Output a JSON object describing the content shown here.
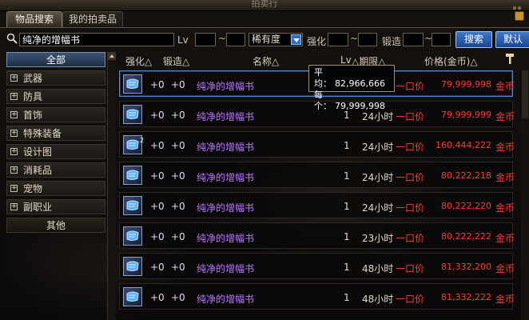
{
  "window": {
    "title": "拍卖行"
  },
  "tabs": [
    {
      "label": "物品搜索"
    },
    {
      "label": "我的拍卖品"
    }
  ],
  "search": {
    "query": "纯净的增幅书",
    "lv_label": "Lv",
    "tilde": "~",
    "rarity_select": "稀有度",
    "enhance_label": "强化",
    "forge_label": "锻造",
    "search_button": "搜索",
    "default_button": "默认"
  },
  "sidebar": {
    "items": [
      {
        "label": "全部",
        "expandable": false,
        "selected": true
      },
      {
        "label": "武器",
        "expandable": true
      },
      {
        "label": "防具",
        "expandable": true
      },
      {
        "label": "首饰",
        "expandable": true
      },
      {
        "label": "特殊装备",
        "expandable": true
      },
      {
        "label": "设计图",
        "expandable": true
      },
      {
        "label": "消耗品",
        "expandable": true
      },
      {
        "label": "宠物",
        "expandable": true
      },
      {
        "label": "副职业",
        "expandable": true
      },
      {
        "label": "其他",
        "expandable": false
      }
    ]
  },
  "columns": {
    "enhance": "强化△",
    "forge": "锻造△",
    "name": "名称△",
    "lv": "Lv",
    "period": "△期限△",
    "price": "价格(金币)△"
  },
  "rows": [
    {
      "enhance": "+0",
      "forge": "+0",
      "name": "纯净的增幅书",
      "lv": "",
      "time": "",
      "buy": "一口价",
      "price": "79,999,998",
      "unit": "金币",
      "qty": "",
      "selected": true
    },
    {
      "enhance": "+0",
      "forge": "+0",
      "name": "纯净的增幅书",
      "lv": "1",
      "time": "24小时",
      "buy": "一口价",
      "price": "79,999,999",
      "unit": "金币",
      "qty": ""
    },
    {
      "enhance": "+0",
      "forge": "+0",
      "name": "纯净的增幅书",
      "lv": "1",
      "time": "24小时",
      "buy": "一口价",
      "price": "160,444,222",
      "unit": "金币",
      "qty": "2"
    },
    {
      "enhance": "+0",
      "forge": "+0",
      "name": "纯净的增幅书",
      "lv": "1",
      "time": "24小时",
      "buy": "一口价",
      "price": "80,222,218",
      "unit": "金币",
      "qty": ""
    },
    {
      "enhance": "+0",
      "forge": "+0",
      "name": "纯净的增幅书",
      "lv": "1",
      "time": "24小时",
      "buy": "一口价",
      "price": "80,222,220",
      "unit": "金币",
      "qty": ""
    },
    {
      "enhance": "+0",
      "forge": "+0",
      "name": "纯净的增幅书",
      "lv": "1",
      "time": "23小时",
      "buy": "一口价",
      "price": "80,222,222",
      "unit": "金币",
      "qty": ""
    },
    {
      "enhance": "+0",
      "forge": "+0",
      "name": "纯净的增幅书",
      "lv": "1",
      "time": "48小时",
      "buy": "一口价",
      "price": "81,332,200",
      "unit": "金币",
      "qty": ""
    },
    {
      "enhance": "+0",
      "forge": "+0",
      "name": "纯净的增幅书",
      "lv": "1",
      "time": "48小时",
      "buy": "一口价",
      "price": "81,332,222",
      "unit": "金币",
      "qty": ""
    }
  ],
  "tooltip": {
    "avg_label": "平均：",
    "avg_value": "82,966,666",
    "each_label": "每个：",
    "each_value": "79,999,998"
  },
  "colors": {
    "accent_blue": "#2f6ec8",
    "price_red": "#ff3b30",
    "item_purple": "#b879ff"
  },
  "icons": {
    "search": "magnifier-icon",
    "sort": "hammer-icon",
    "item": "blue-scroll-icon"
  }
}
